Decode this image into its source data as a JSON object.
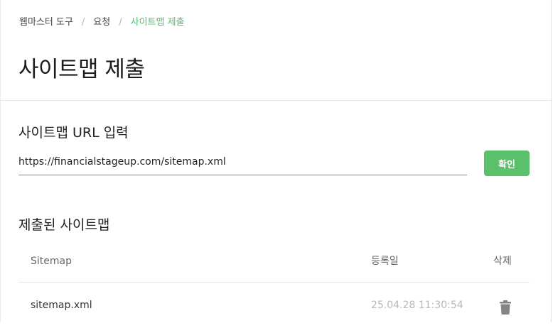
{
  "breadcrumb": {
    "items": [
      "웹마스터 도구",
      "요청",
      "사이트맵 제출"
    ],
    "separator": "/"
  },
  "page": {
    "title": "사이트맵 제출"
  },
  "url_section": {
    "title": "사이트맵 URL 입력",
    "input_value": "https://financialstageup.com/sitemap.xml",
    "confirm_label": "확인"
  },
  "list_section": {
    "title": "제출된 사이트맵",
    "columns": {
      "sitemap": "Sitemap",
      "date": "등록일",
      "delete": "삭제"
    },
    "rows": [
      {
        "name": "sitemap.xml",
        "date": "25.04.28 11:30:54",
        "delete_icon": "trash-icon"
      }
    ]
  },
  "colors": {
    "accent": "#5ac06b",
    "active_crumb": "#53c06a",
    "muted": "#b8b8b8"
  }
}
